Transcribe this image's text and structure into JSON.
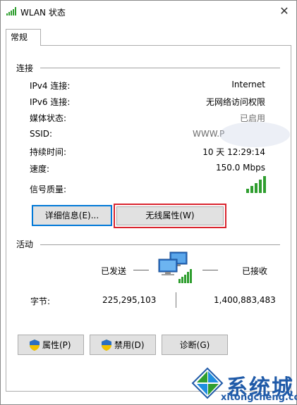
{
  "window": {
    "title": "WLAN 状态",
    "close_glyph": "✕"
  },
  "tabs": [
    {
      "label": "常规"
    }
  ],
  "connection": {
    "section_label": "连接",
    "rows": [
      {
        "label": "IPv4 连接:",
        "value": "Internet"
      },
      {
        "label": "IPv6 连接:",
        "value": "无网络访问权限"
      },
      {
        "label": "媒体状态:",
        "value": "已启用"
      },
      {
        "label": "SSID:",
        "value": "WWW.P"
      },
      {
        "label": "持续时间:",
        "value": "10 天 12:29:14"
      },
      {
        "label": "速度:",
        "value": "150.0 Mbps"
      },
      {
        "label": "信号质量:",
        "value": ""
      }
    ],
    "signal_bars_filled": 5,
    "signal_bars_total": 5
  },
  "buttons_top": {
    "details": "详细信息(E)...",
    "wireless_properties": "无线属性(W)"
  },
  "activity": {
    "section_label": "活动",
    "sent_label": "已发送",
    "received_label": "已接收",
    "bytes_label": "字节:",
    "bytes_sent": "225,295,103",
    "bytes_received": "1,400,883,483"
  },
  "buttons_bottom": {
    "properties": "属性(P)",
    "disable": "禁用(D)",
    "diagnose": "诊断(G)"
  },
  "watermark": {
    "brand": "系统城",
    "url": "xitongcheng.com"
  },
  "colors": {
    "accent": "#0078d7",
    "highlight": "#d9242e",
    "signal_green": "#2f9e2f",
    "brand_blue": "#1f5aa8"
  }
}
